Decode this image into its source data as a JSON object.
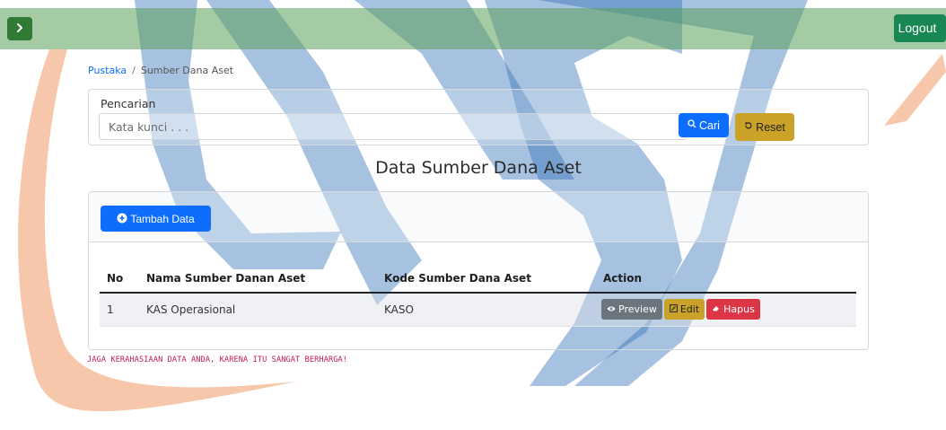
{
  "header": {
    "toggle_icon": "chevron-right-icon",
    "logout_label": "Logout"
  },
  "breadcrumb": {
    "parent": "Pustaka",
    "separator": "/",
    "current": "Sumber Dana Aset"
  },
  "search": {
    "label": "Pencarian",
    "placeholder": "Kata kunci . . .",
    "value": "",
    "search_button": "Cari",
    "reset_button": "Reset"
  },
  "page_title": "Data Sumber Dana Aset",
  "card": {
    "add_button": "Tambah Data"
  },
  "table": {
    "headers": [
      "No",
      "Nama Sumber Danan Aset",
      "Kode Sumber Dana Aset",
      "Action"
    ],
    "rows": [
      {
        "no": "1",
        "nama": "KAS Operasional",
        "kode": "KASO",
        "actions": {
          "preview": "Preview",
          "edit": "Edit",
          "hapus": "Hapus"
        }
      }
    ]
  },
  "footer_note": "JAGA KERAHASIAAN DATA ANDA, KARENA ITU SANGAT BERHARGA!",
  "colors": {
    "topbar": "#5aa05a",
    "primary": "#0d6efd",
    "warning": "#c9a227",
    "danger": "#dc3545",
    "secondary": "#6c757d",
    "success": "#198754",
    "watermark_blue": "#2e6eb5",
    "watermark_orange": "#f0a070",
    "footer_note": "#c2185b"
  }
}
